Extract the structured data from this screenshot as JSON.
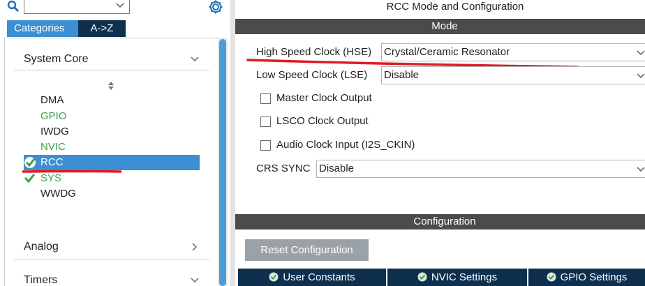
{
  "search": {
    "value": ""
  },
  "tabs": {
    "categories": "Categories",
    "az": "A->Z"
  },
  "tree": {
    "groups": {
      "system_core": "System Core",
      "analog": "Analog",
      "timers": "Timers"
    },
    "items": [
      {
        "label": "DMA",
        "status": "none"
      },
      {
        "label": "GPIO",
        "status": "configured"
      },
      {
        "label": "IWDG",
        "status": "none"
      },
      {
        "label": "NVIC",
        "status": "configured"
      },
      {
        "label": "RCC",
        "status": "checked",
        "selected": true
      },
      {
        "label": "SYS",
        "status": "checked"
      },
      {
        "label": "WWDG",
        "status": "none"
      }
    ]
  },
  "panel": {
    "title": "RCC Mode and Configuration",
    "mode_header": "Mode",
    "hse": {
      "label": "High Speed Clock (HSE)",
      "value": "Crystal/Ceramic Resonator"
    },
    "lse": {
      "label": "Low Speed Clock (LSE)",
      "value": "Disable"
    },
    "checkboxes": {
      "mco": "Master Clock Output",
      "lsco": "LSCO Clock Output",
      "audio": "Audio Clock Input (I2S_CKIN)"
    },
    "crs": {
      "label": "CRS SYNC",
      "value": "Disable"
    },
    "config_header": "Configuration",
    "reset_label": "Reset Configuration",
    "config_tabs": {
      "user_constants": "User Constants",
      "nvic_settings": "NVIC Settings",
      "gpio_settings": "GPIO Settings"
    }
  },
  "colors": {
    "accent_blue": "#3c8fd2",
    "dark_navy": "#0f2f4f",
    "configured_green": "#3aa14a",
    "annotation_red": "#e01b24",
    "header_gray": "#4b4b4b"
  },
  "icons": [
    "search-icon",
    "gear-icon",
    "chevron-down-icon",
    "chevron-right-icon",
    "sort-icon",
    "check-icon",
    "ok-icon"
  ]
}
